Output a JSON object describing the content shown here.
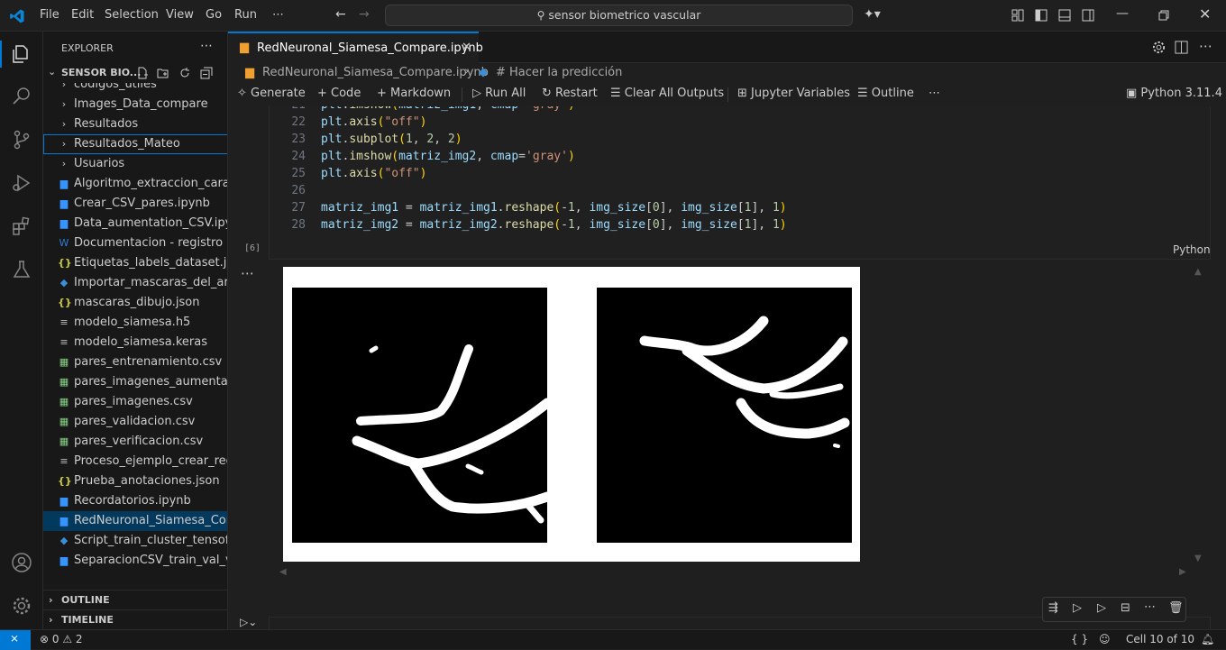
{
  "titlebar": {
    "menu": [
      "File",
      "Edit",
      "Selection",
      "View",
      "Go",
      "Run",
      "⋯"
    ],
    "search": "sensor biometrico vascular"
  },
  "explorer": {
    "header": "EXPLORER",
    "folder": "SENSOR BIO...",
    "items": [
      {
        "kind": "folder",
        "label": "codigos_utiles"
      },
      {
        "kind": "folder",
        "label": "Images_Data_compare"
      },
      {
        "kind": "folder",
        "label": "Resultados"
      },
      {
        "kind": "folder",
        "label": "Resultados_Mateo"
      },
      {
        "kind": "folder",
        "label": "Usuarios"
      },
      {
        "kind": "nb",
        "label": "Algoritmo_extraccion_carac..."
      },
      {
        "kind": "nb",
        "label": "Crear_CSV_pares.ipynb"
      },
      {
        "kind": "nb",
        "label": "Data_aumentation_CSV.ipynb"
      },
      {
        "kind": "word",
        "label": "Documentacion - registro r..."
      },
      {
        "kind": "json",
        "label": "Etiquetas_labels_dataset.json"
      },
      {
        "kind": "py",
        "label": "Importar_mascaras_del_arc..."
      },
      {
        "kind": "json",
        "label": "mascaras_dibujo.json"
      },
      {
        "kind": "h5",
        "label": "modelo_siamesa.h5"
      },
      {
        "kind": "h5",
        "label": "modelo_siamesa.keras"
      },
      {
        "kind": "csv",
        "label": "pares_entrenamiento.csv"
      },
      {
        "kind": "csv",
        "label": "pares_imagenes_aumentad..."
      },
      {
        "kind": "csv",
        "label": "pares_imagenes.csv"
      },
      {
        "kind": "csv",
        "label": "pares_validacion.csv"
      },
      {
        "kind": "csv",
        "label": "pares_verificacion.csv"
      },
      {
        "kind": "nb",
        "label": "Proceso_ejemplo_crear_red..."
      },
      {
        "kind": "json",
        "label": "Prueba_anotaciones.json"
      },
      {
        "kind": "nb",
        "label": "Recordatorios.ipynb"
      },
      {
        "kind": "nb",
        "label": "RedNeuronal_Siamesa_Com..."
      },
      {
        "kind": "py",
        "label": "Script_train_cluster_tensoflo..."
      },
      {
        "kind": "nb",
        "label": "SeparacionCSV_train_val_ve..."
      }
    ],
    "outline": "OUTLINE",
    "timeline": "TIMELINE"
  },
  "editor": {
    "tab": "RedNeuronal_Siamesa_Compare.ipynb",
    "breadcrumb_file": "RedNeuronal_Siamesa_Compare.ipynb",
    "breadcrumb_section": "# Hacer la predicción",
    "toolbar": {
      "generate": "Generate",
      "code": "Code",
      "markdown": "Markdown",
      "run_all": "Run All",
      "restart": "Restart",
      "clear": "Clear All Outputs",
      "variables": "Jupyter Variables",
      "outline": "Outline",
      "kernel": "Python 3.11.4"
    },
    "exec_count": "[6]",
    "language": "Python"
  },
  "statusbar": {
    "errors": "0",
    "warnings": "2",
    "braces": "{ }",
    "cell": "Cell 10 of 10"
  },
  "colors": {
    "accent": "#0078d4",
    "bg": "#1f1f1f",
    "sidebar": "#181818"
  }
}
